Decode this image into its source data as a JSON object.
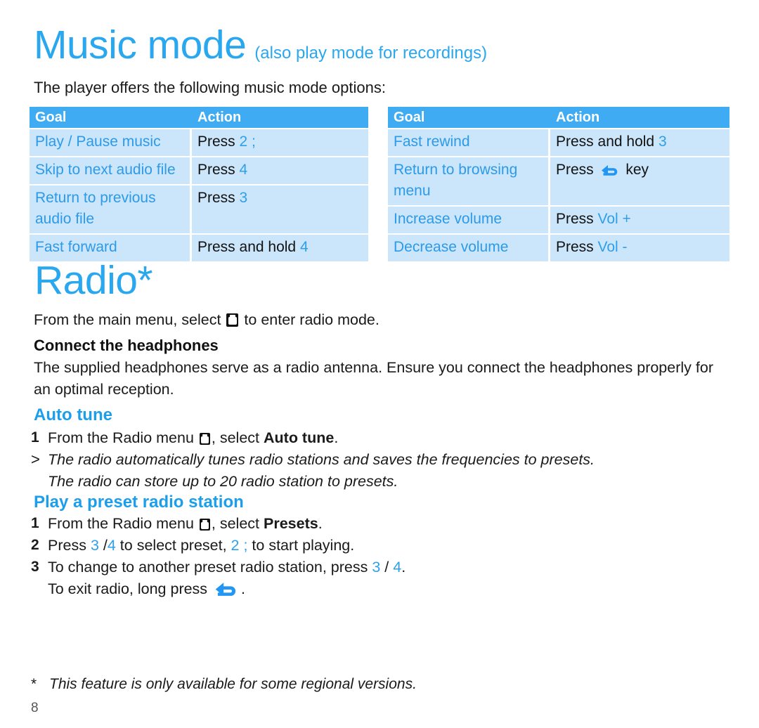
{
  "heading": {
    "title": "Music mode",
    "subtitle": "(also play mode for recordings)",
    "intro": "The player offers the following music mode options:"
  },
  "tables": {
    "left": {
      "headers": {
        "goal": "Goal",
        "action": "Action"
      },
      "rows": [
        {
          "goal": "Play / Pause music",
          "action_prefix": "Press ",
          "action_key": "2 ;",
          "action_suffix": ""
        },
        {
          "goal": "Skip to next audio file",
          "action_prefix": "Press ",
          "action_key": "4",
          "action_suffix": ""
        },
        {
          "goal": "Return to previous audio file",
          "action_prefix": "Press ",
          "action_key": "3",
          "action_suffix": ""
        },
        {
          "goal": "Fast forward",
          "action_prefix": "Press and hold ",
          "action_key": "4",
          "action_suffix": ""
        }
      ]
    },
    "right": {
      "headers": {
        "goal": "Goal",
        "action": "Action"
      },
      "rows": [
        {
          "goal": "Fast rewind",
          "action_prefix": "Press and hold ",
          "action_key": "3",
          "action_suffix": ""
        },
        {
          "goal": "Return to browsing menu",
          "action_prefix": "Press ",
          "action_key": "",
          "action_suffix": " key"
        },
        {
          "goal": "Increase volume",
          "action_prefix": "Press ",
          "action_key": "Vol +",
          "action_suffix": ""
        },
        {
          "goal": "Decrease volume",
          "action_prefix": "Press ",
          "action_key": "Vol -",
          "action_suffix": ""
        }
      ]
    }
  },
  "radio": {
    "title": "Radio*",
    "enter_line_before": "From the main menu, select ",
    "enter_line_after": " to enter radio mode.",
    "connect_heading": "Connect the headphones",
    "connect_body": "The supplied headphones serve as a radio antenna. Ensure you connect the headphones properly for an optimal reception."
  },
  "auto_tune": {
    "heading": "Auto tune",
    "step1_marker": "1",
    "step1_before": "From the Radio menu ",
    "step1_after_icon": ", select ",
    "step1_bold": "Auto tune",
    "step1_end": ".",
    "note_marker": ">",
    "note_line1": "The radio automatically tunes radio stations and saves the frequencies to presets.",
    "note_line2": "The radio can store up to 20 radio station to presets."
  },
  "preset": {
    "heading": "Play a preset radio station",
    "step1_marker": "1",
    "step1_before": "From the Radio menu ",
    "step1_after_icon": ", select ",
    "step1_bold": "Presets",
    "step1_end": ".",
    "step2_marker": "2",
    "step2_a": "Press ",
    "step2_k1": "3",
    "step2_b": " /",
    "step2_k2": "4",
    "step2_c": "  to select preset, ",
    "step2_k3": "2 ;",
    "step2_d": "  to start playing.",
    "step3_marker": "3",
    "step3_a": "To change to another preset radio station, press ",
    "step3_k1": "3",
    "step3_b": " / ",
    "step3_k2": "4",
    "step3_c": ".",
    "step3_cont_before": "To exit radio, long press ",
    "step3_cont_after": "."
  },
  "footer": {
    "star": "*",
    "note": "This feature is only available for some regional versions.",
    "page_number": "8"
  },
  "icons": {
    "radio_menu": "radio-menu-icon",
    "back_key": "back-arrow-icon"
  },
  "colors": {
    "accent_blue": "#29a7ef",
    "header_blue": "#3fabf2",
    "row_blue": "#cbe6fb",
    "key_blue": "#2f9fe8",
    "text_black": "#1a1a1a"
  }
}
